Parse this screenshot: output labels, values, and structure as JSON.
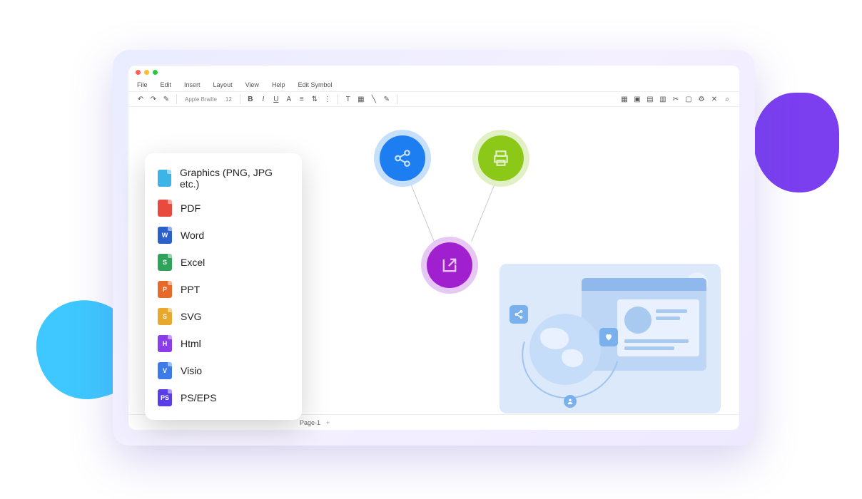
{
  "menubar": [
    "File",
    "Edit",
    "Insert",
    "Layout",
    "View",
    "Help",
    "Edit Symbol"
  ],
  "font": {
    "name": "Apple Braille",
    "size": "12"
  },
  "toolbar_labels": {
    "bold": "B",
    "italic": "I",
    "underline": "U",
    "align": "A"
  },
  "export_menu": [
    {
      "label": "Graphics (PNG, JPG etc.)",
      "color": "#3db4e8",
      "letter": ""
    },
    {
      "label": "PDF",
      "color": "#e84a3d",
      "letter": ""
    },
    {
      "label": "Word",
      "color": "#2b5fc9",
      "letter": "W"
    },
    {
      "label": "Excel",
      "color": "#2fa35a",
      "letter": "S"
    },
    {
      "label": "PPT",
      "color": "#e86a2b",
      "letter": "P"
    },
    {
      "label": "SVG",
      "color": "#e8a82b",
      "letter": "S"
    },
    {
      "label": "Html",
      "color": "#8a3de8",
      "letter": "H"
    },
    {
      "label": "Visio",
      "color": "#3d7ce8",
      "letter": "V"
    },
    {
      "label": "PS/EPS",
      "color": "#5a3de8",
      "letter": "PS"
    }
  ],
  "tabs": {
    "active": "Page-1",
    "add": "+"
  }
}
